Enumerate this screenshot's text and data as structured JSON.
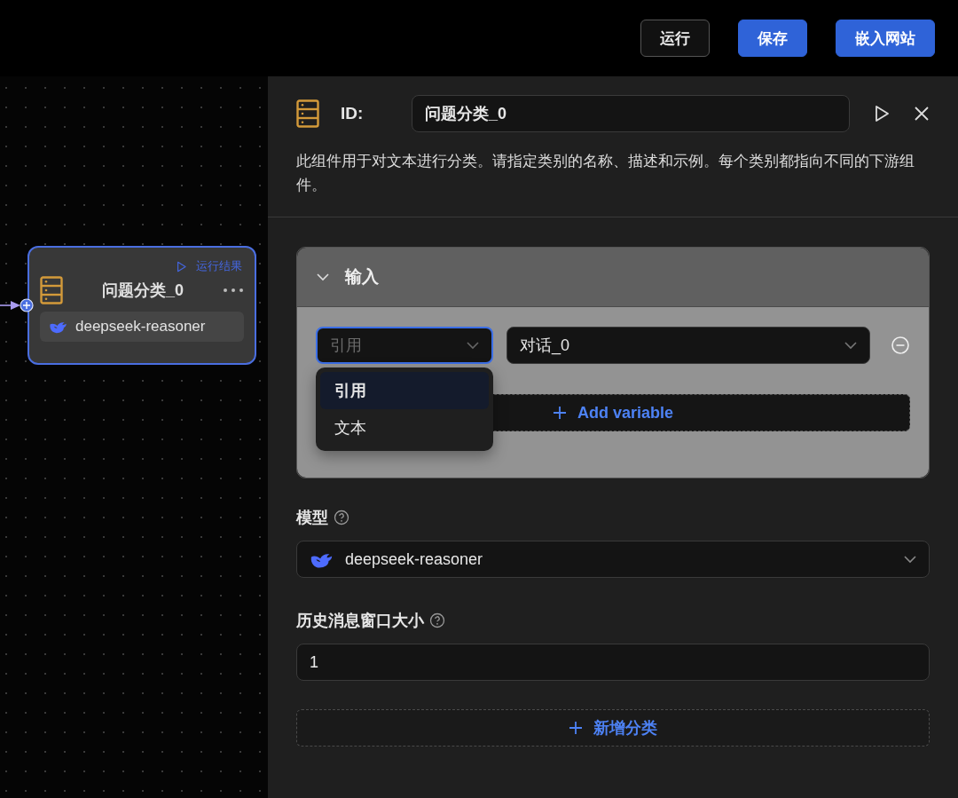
{
  "toolbar": {
    "buttons": [
      {
        "label": "运行",
        "kind": "outline"
      },
      {
        "label": "保存",
        "kind": "primary"
      },
      {
        "label": "嵌入网站",
        "kind": "primary"
      }
    ]
  },
  "canvas": {
    "node": {
      "title": "问题分类_0",
      "run_result": "运行结果",
      "model": "deepseek-reasoner",
      "selected": true
    }
  },
  "panel": {
    "id_label": "ID:",
    "id_value": "问题分类_0",
    "description": "此组件用于对文本进行分类。请指定类别的名称、描述和示例。每个类别都指向不同的下游组件。",
    "input_section": {
      "title": "输入",
      "expanded": true,
      "variables": [
        {
          "type_select": {
            "placeholder": "引用",
            "open": true,
            "options": [
              {
                "label": "引用",
                "selected": true
              },
              {
                "label": "文本",
                "selected": false
              }
            ]
          },
          "value_select": {
            "value": "对话_0"
          }
        }
      ],
      "add_button": "Add variable"
    },
    "model": {
      "label": "模型",
      "value": "deepseek-reasoner"
    },
    "history": {
      "label": "历史消息窗口大小",
      "value": "1"
    },
    "add_category": "新增分类"
  }
}
